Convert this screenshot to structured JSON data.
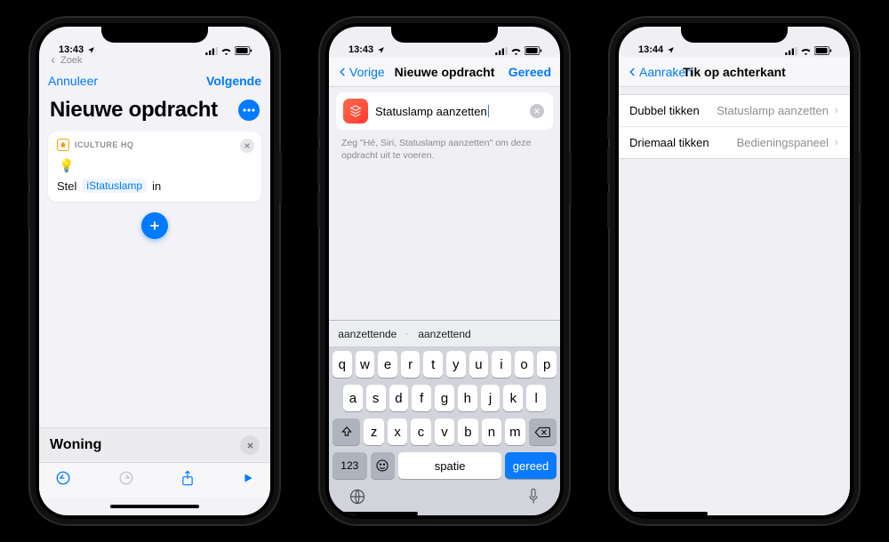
{
  "status": {
    "time1": "13:43",
    "time3": "13:44"
  },
  "phone1": {
    "search_hint": "Zoek",
    "cancel": "Annuleer",
    "next": "Volgende",
    "title": "Nieuwe opdracht",
    "card_header": "ICULTURE HQ",
    "sentence_pre": "Stel",
    "chip": "iStatuslamp",
    "sentence_post": "in",
    "woning": "Woning"
  },
  "phone2": {
    "back": "Vorige",
    "title": "Nieuwe opdracht",
    "done": "Gereed",
    "name_value": "Statuslamp aanzetten",
    "hint": "Zeg \"Hé, Siri, Statuslamp aanzetten\" om deze opdracht uit te voeren.",
    "suggestions": [
      "aanzettende",
      "aanzettend",
      ""
    ],
    "rows": {
      "r1": [
        "q",
        "w",
        "e",
        "r",
        "t",
        "y",
        "u",
        "i",
        "o",
        "p"
      ],
      "r2": [
        "a",
        "s",
        "d",
        "f",
        "g",
        "h",
        "j",
        "k",
        "l"
      ],
      "r3": [
        "z",
        "x",
        "c",
        "v",
        "b",
        "n",
        "m"
      ]
    },
    "key123": "123",
    "space": "spatie",
    "ret": "gereed"
  },
  "phone3": {
    "back": "Aanraken",
    "title": "Tik op achterkant",
    "rows": [
      {
        "label": "Dubbel tikken",
        "value": "Statuslamp aanzetten"
      },
      {
        "label": "Driemaal tikken",
        "value": "Bedieningspaneel"
      }
    ]
  }
}
